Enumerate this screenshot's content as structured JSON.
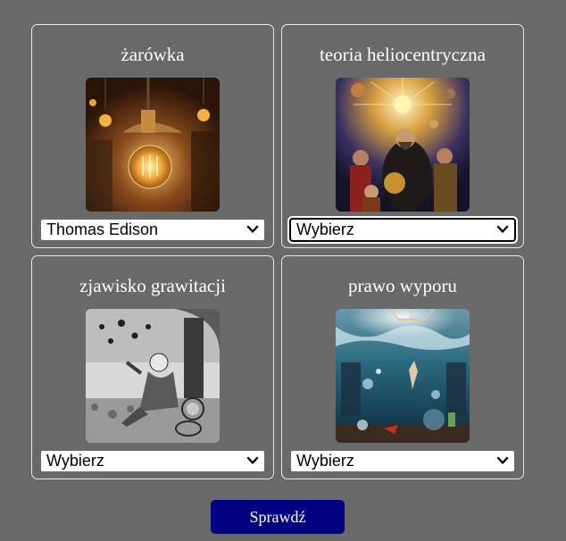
{
  "cards": [
    {
      "title": "żarówka",
      "selected": "Thomas Edison",
      "image": "vintage-light-bulb-image"
    },
    {
      "title": "teoria heliocentryczna",
      "selected": "Wybierz",
      "image": "copernicus-solar-system-image"
    },
    {
      "title": "zjawisko grawitacji",
      "selected": "Wybierz",
      "image": "newton-apple-tree-image"
    },
    {
      "title": "prawo wyporu",
      "selected": "Wybierz",
      "image": "archimedes-underwater-image"
    }
  ],
  "check_button": "Sprawdź",
  "colors": {
    "page_background": "#696969",
    "button_background": "#000080",
    "card_border": "#e8e8e8"
  }
}
